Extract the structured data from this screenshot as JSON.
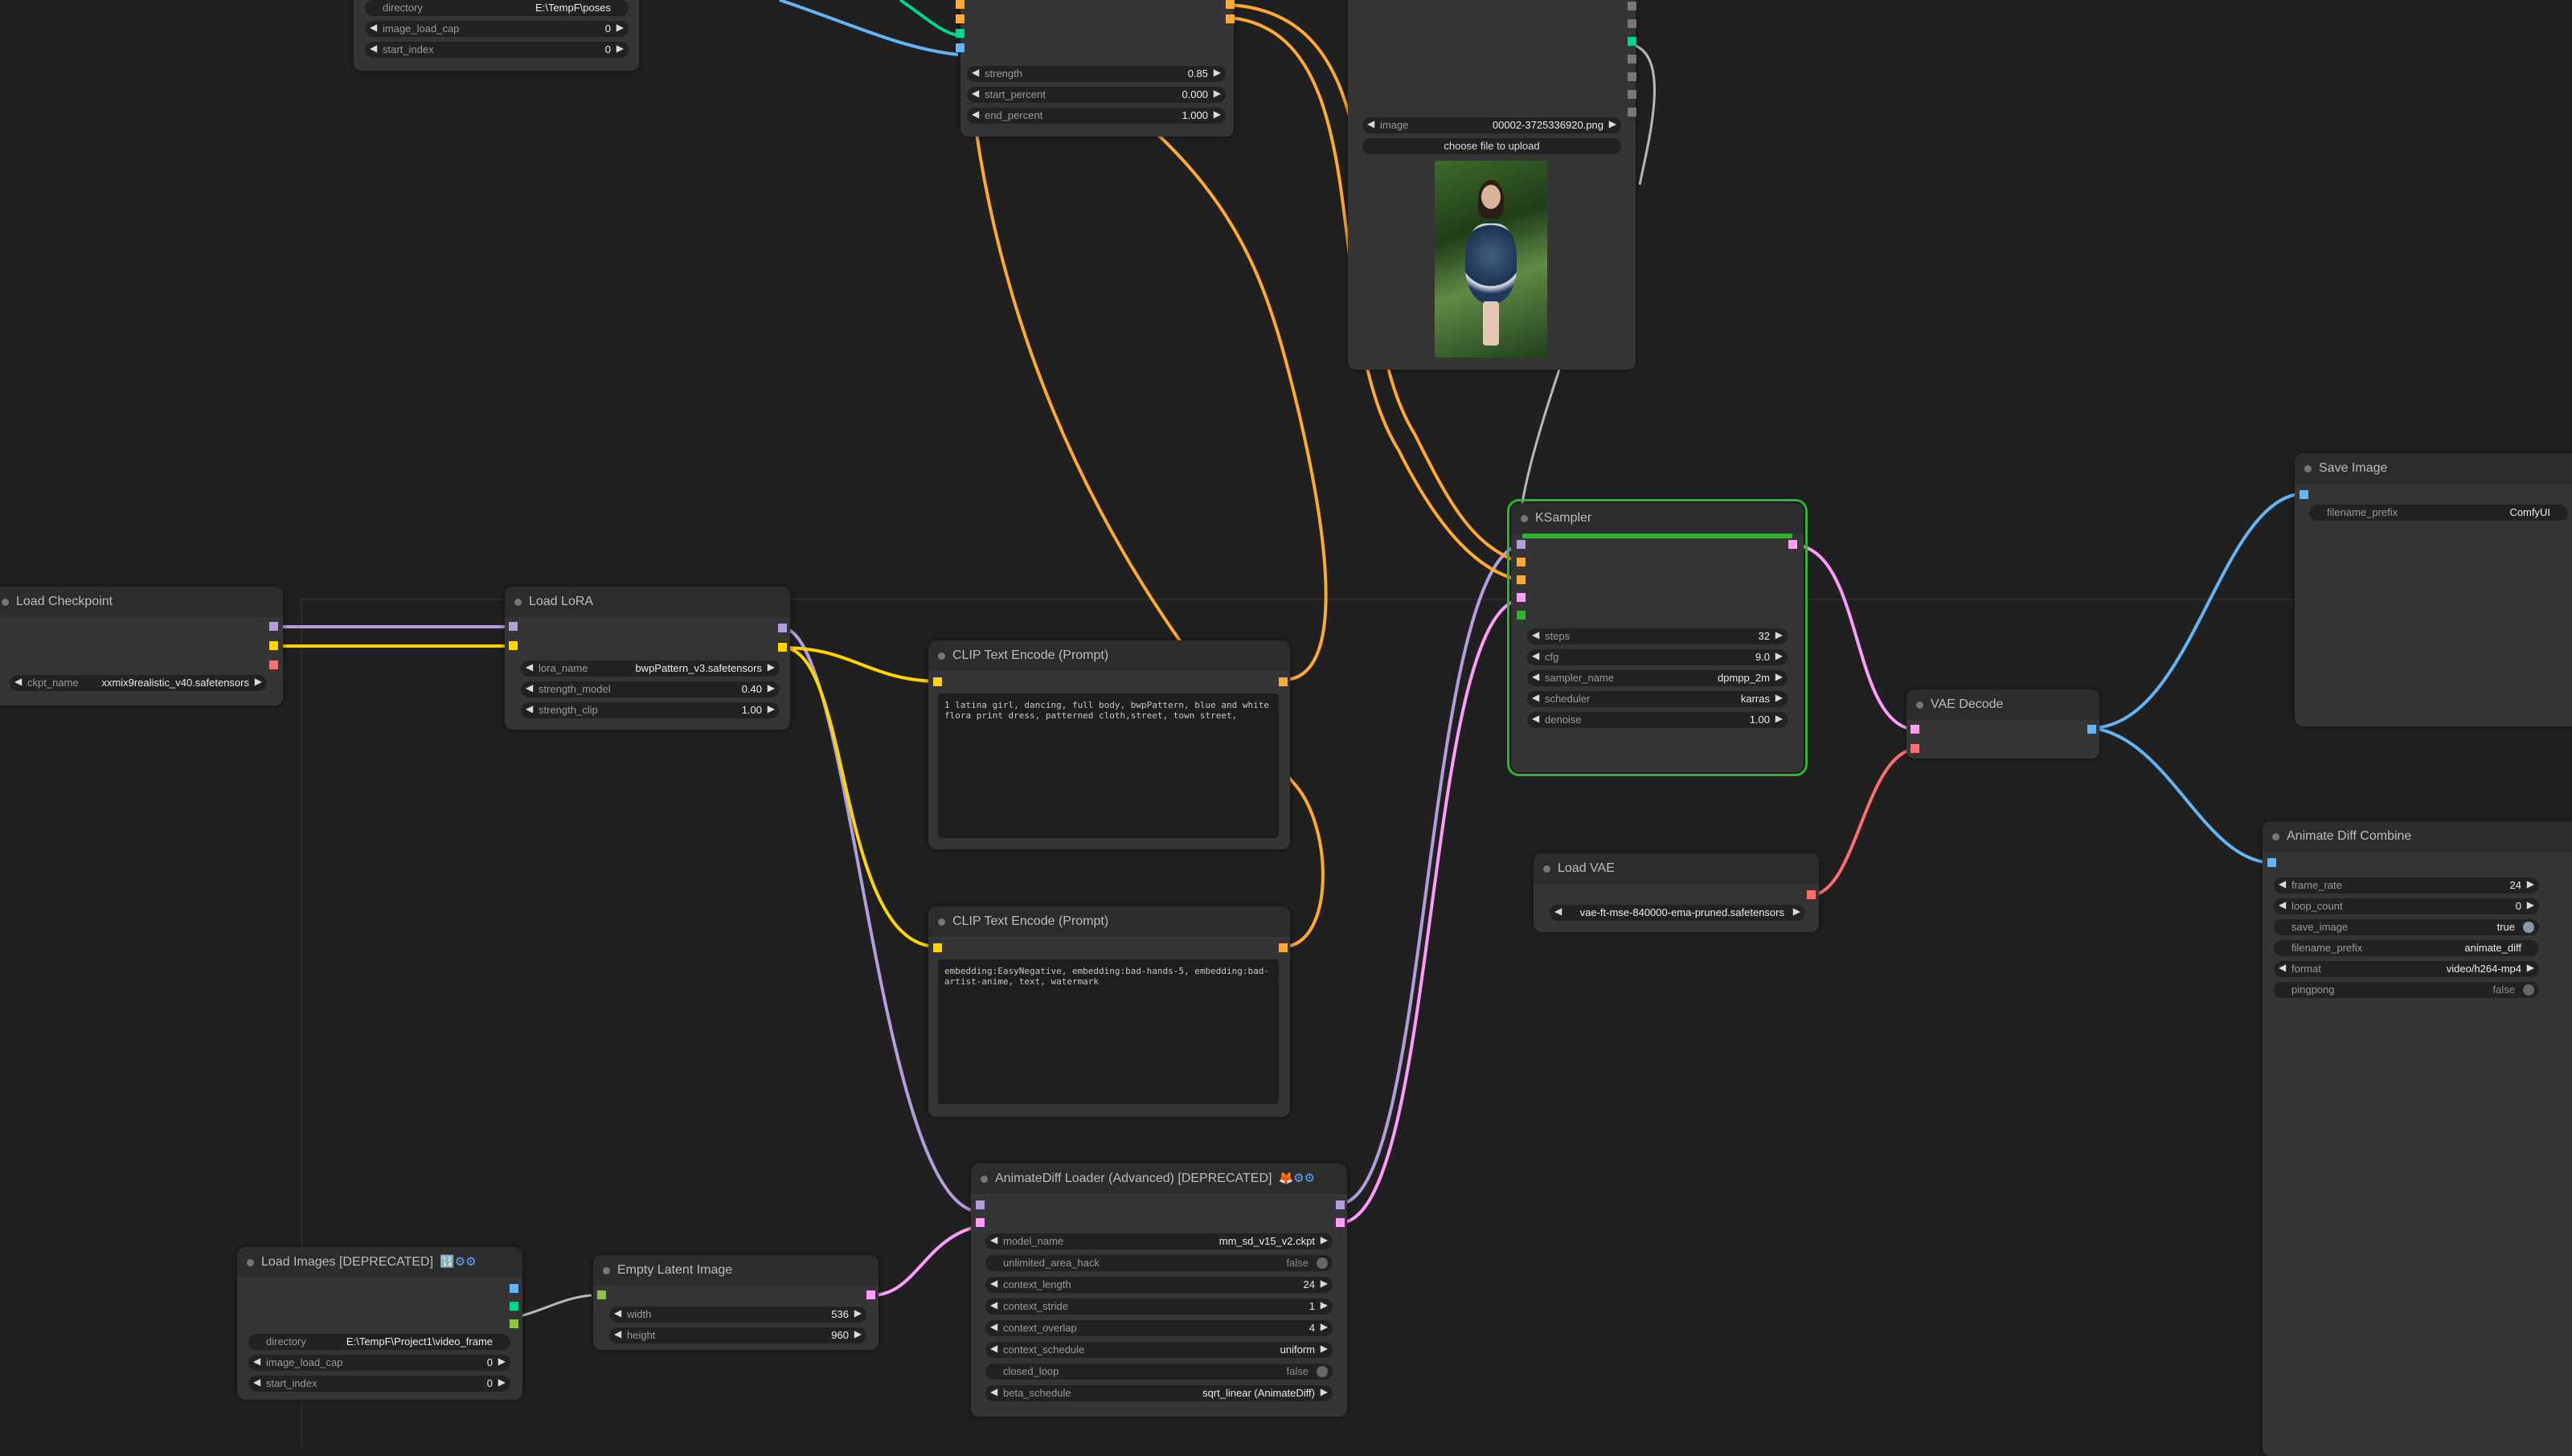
{
  "nodes": {
    "load_images_top": {
      "directory_label": "directory",
      "directory_value": "E:\\TempF\\poses",
      "image_load_cap_label": "image_load_cap",
      "image_load_cap_value": "0",
      "start_index_label": "start_index",
      "start_index_value": "0"
    },
    "controlnet_apply": {
      "strength_label": "strength",
      "strength_value": "0.85",
      "start_percent_label": "start_percent",
      "start_percent_value": "0.000",
      "end_percent_label": "end_percent",
      "end_percent_value": "1.000"
    },
    "load_image": {
      "image_label": "image",
      "image_value": "00002-3725336920.png",
      "upload_label": "choose file to upload"
    },
    "load_checkpoint": {
      "title": "Load Checkpoint",
      "ckpt_label": "ckpt_name",
      "ckpt_value": "xxmix9realistic_v40.safetensors"
    },
    "load_lora": {
      "title": "Load LoRA",
      "lora_name_label": "lora_name",
      "lora_name_value": "bwpPattern_v3.safetensors",
      "strength_model_label": "strength_model",
      "strength_model_value": "0.40",
      "strength_clip_label": "strength_clip",
      "strength_clip_value": "1.00"
    },
    "clip_positive": {
      "title": "CLIP Text Encode (Prompt)",
      "text": "1 latina girl, dancing, full body, bwpPattern, blue and white flora print dress, patterned cloth,street, town street,"
    },
    "clip_negative": {
      "title": "CLIP Text Encode (Prompt)",
      "text": "embedding:EasyNegative, embedding:bad-hands-5, embedding:bad-artist-anime, text, watermark"
    },
    "ksampler": {
      "title": "KSampler",
      "steps_label": "steps",
      "steps_value": "32",
      "cfg_label": "cfg",
      "cfg_value": "9.0",
      "sampler_label": "sampler_name",
      "sampler_value": "dpmpp_2m",
      "scheduler_label": "scheduler",
      "scheduler_value": "karras",
      "denoise_label": "denoise",
      "denoise_value": "1.00"
    },
    "vae_decode": {
      "title": "VAE Decode"
    },
    "load_vae": {
      "title": "Load VAE",
      "vae_value": "vae-ft-mse-840000-ema-pruned.safetensors"
    },
    "save_image": {
      "title": "Save Image",
      "prefix_label": "filename_prefix",
      "prefix_value": "ComfyUI"
    },
    "animatediff_combine": {
      "title": "Animate Diff Combine",
      "frame_rate_label": "frame_rate",
      "frame_rate_value": "24",
      "loop_count_label": "loop_count",
      "loop_count_value": "0",
      "save_image_label": "save_image",
      "save_image_value": "true",
      "prefix_label": "filename_prefix",
      "prefix_value": "animate_diff",
      "format_label": "format",
      "format_value": "video/h264-mp4",
      "pingpong_label": "pingpong",
      "pingpong_value": "false"
    },
    "animatediff_loader": {
      "title": "AnimateDiff Loader (Advanced) [DEPRECATED]",
      "model_label": "model_name",
      "model_value": "mm_sd_v15_v2.ckpt",
      "unlimited_label": "unlimited_area_hack",
      "unlimited_value": "false",
      "context_length_label": "context_length",
      "context_length_value": "24",
      "context_stride_label": "context_stride",
      "context_stride_value": "1",
      "context_overlap_label": "context_overlap",
      "context_overlap_value": "4",
      "context_schedule_label": "context_schedule",
      "context_schedule_value": "uniform",
      "closed_loop_label": "closed_loop",
      "closed_loop_value": "false",
      "beta_label": "beta_schedule",
      "beta_value": "sqrt_linear (AnimateDiff)"
    },
    "load_images_bottom": {
      "title": "Load Images [DEPRECATED]",
      "directory_label": "directory",
      "directory_value": "E:\\TempF\\Project1\\video_frame",
      "image_load_cap_label": "image_load_cap",
      "image_load_cap_value": "0",
      "start_index_label": "start_index",
      "start_index_value": "0"
    },
    "empty_latent": {
      "title": "Empty Latent Image",
      "width_label": "width",
      "width_value": "536",
      "height_label": "height",
      "height_value": "960"
    }
  },
  "colors": {
    "model": "#b39ddb",
    "clip": "#ffd500",
    "conditioning": "#ffa931",
    "latent": "#ff9cf9",
    "vae": "#ff6e6e",
    "image": "#64b5f6",
    "controlnet": "#00d78d",
    "selected": "#2fb52f"
  }
}
